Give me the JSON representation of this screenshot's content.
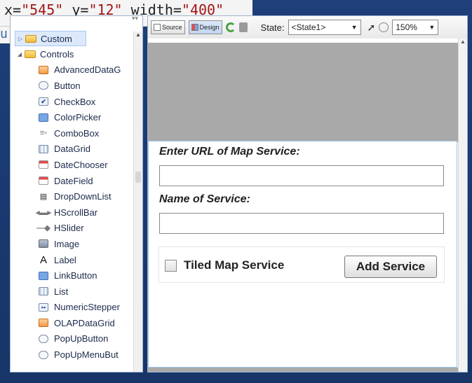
{
  "code": {
    "line1_prefix": "x=",
    "x_val": "\"545\"",
    "y_attr": " y=",
    "y_val": "\"12\"",
    "w_attr": " width=",
    "w_val": "\"400\"",
    "line2": "u"
  },
  "components": {
    "custom_label": "Custom",
    "controls_label": "Controls",
    "items": [
      {
        "label": "AdvancedDataG",
        "icon": "advanced-datagrid-icon"
      },
      {
        "label": "Button",
        "icon": "button-icon"
      },
      {
        "label": "CheckBox",
        "icon": "checkbox-icon"
      },
      {
        "label": "ColorPicker",
        "icon": "colorpicker-icon"
      },
      {
        "label": "ComboBox",
        "icon": "combobox-icon"
      },
      {
        "label": "DataGrid",
        "icon": "datagrid-icon"
      },
      {
        "label": "DateChooser",
        "icon": "datechooser-icon"
      },
      {
        "label": "DateField",
        "icon": "datefield-icon"
      },
      {
        "label": "DropDownList",
        "icon": "dropdownlist-icon"
      },
      {
        "label": "HScrollBar",
        "icon": "hscrollbar-icon"
      },
      {
        "label": "HSlider",
        "icon": "hslider-icon"
      },
      {
        "label": "Image",
        "icon": "image-icon"
      },
      {
        "label": "Label",
        "icon": "label-icon"
      },
      {
        "label": "LinkButton",
        "icon": "linkbutton-icon"
      },
      {
        "label": "List",
        "icon": "list-icon"
      },
      {
        "label": "NumericStepper",
        "icon": "numericstepper-icon"
      },
      {
        "label": "OLAPDataGrid",
        "icon": "olap-datagrid-icon"
      },
      {
        "label": "PopUpButton",
        "icon": "popupbutton-icon"
      },
      {
        "label": "PopUpMenuBut",
        "icon": "popupmenubutton-icon"
      }
    ]
  },
  "toolbar": {
    "source_label": "Source",
    "design_label": "Design",
    "state_label": "State:",
    "state_value": "<State1>",
    "zoom_value": "150%"
  },
  "form": {
    "url_label": "Enter URL of Map Service:",
    "url_value": "",
    "name_label": "Name of Service:",
    "name_value": "",
    "tiled_label": "Tiled Map Service",
    "tiled_checked": false,
    "add_button": "Add Service"
  }
}
